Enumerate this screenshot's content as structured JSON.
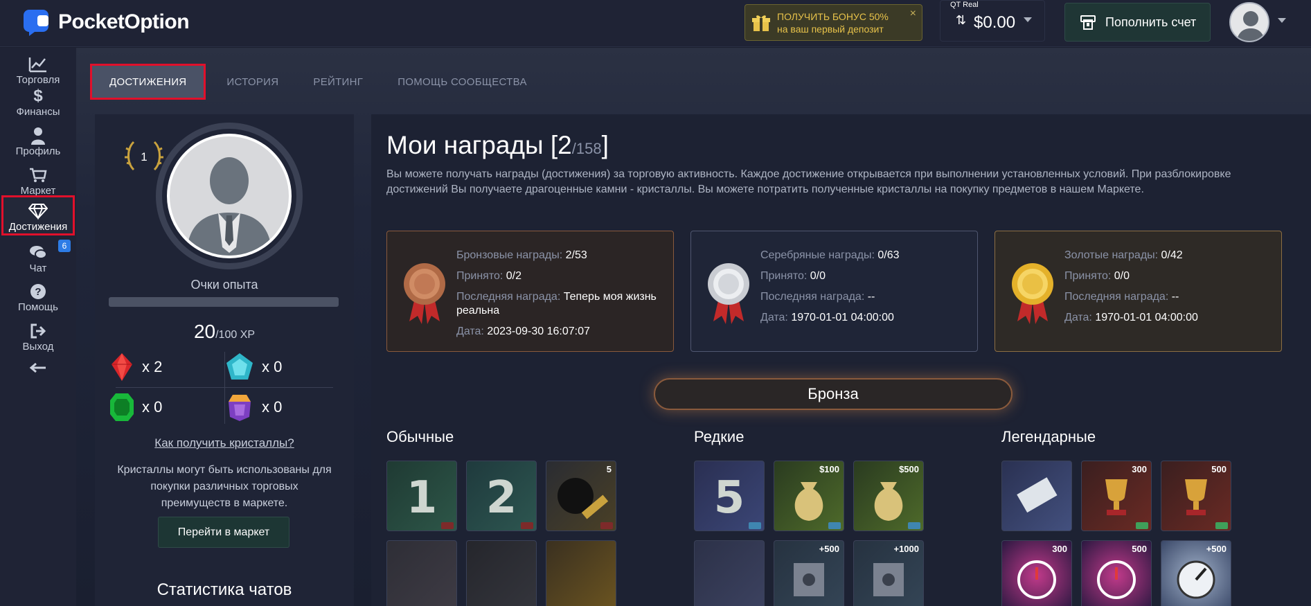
{
  "brand": {
    "name": "PocketOption"
  },
  "header": {
    "bonus_line1": "ПОЛУЧИТЬ БОНУС 50%",
    "bonus_line2": "на ваш первый депозит",
    "bonus_close": "×",
    "account_type": "QT Real",
    "balance": "$0.00",
    "deposit_label": "Пополнить счет"
  },
  "sidebar": {
    "items": [
      {
        "label": "Торговля",
        "icon": "chart-line-icon"
      },
      {
        "label": "Финансы",
        "icon": "dollar-icon"
      },
      {
        "label": "Профиль",
        "icon": "user-icon"
      },
      {
        "label": "Маркет",
        "icon": "cart-icon"
      },
      {
        "label": "Достижения",
        "icon": "diamond-icon"
      },
      {
        "label": "Чат",
        "icon": "chat-icon"
      },
      {
        "label": "Помощь",
        "icon": "question-icon"
      },
      {
        "label": "Выход",
        "icon": "logout-icon"
      }
    ],
    "chat_badge": "6",
    "collapse_icon": "arrow-left-icon"
  },
  "tabs": [
    {
      "label": "ДОСТИЖЕНИЯ",
      "active": true
    },
    {
      "label": "ИСТОРИЯ",
      "active": false
    },
    {
      "label": "РЕЙТИНГ",
      "active": false
    },
    {
      "label": "ПОМОЩЬ СООБЩЕСТВА",
      "active": false
    }
  ],
  "profile": {
    "level": "1",
    "xp_label": "Очки опыта",
    "xp_current": "20",
    "xp_total": "/100 XP",
    "xp_progress": 0.2,
    "gems": [
      {
        "name": "ruby",
        "count": "x 2"
      },
      {
        "name": "sapphire",
        "count": "x 0"
      },
      {
        "name": "emerald",
        "count": "x 0"
      },
      {
        "name": "amethyst",
        "count": "x 0"
      }
    ],
    "how_link": "Как получить кристаллы?",
    "crystals_text": "Кристаллы могут быть использованы для покупки различных торговых преимуществ в маркете.",
    "market_button": "Перейти в маркет",
    "chat_stats_title": "Статистика чатов"
  },
  "rewards": {
    "title": "Мои награды [2",
    "title_total": "/158",
    "title_close": "]",
    "description": "Вы можете получать награды (достижения) за торговую активность. Каждое достижение открывается при выполнении установленных условий. При разблокировке достижений Вы получаете драгоценные камни - кристаллы. Вы можете потратить полученные кристаллы на покупку предметов в нашем Маркете.",
    "cards": [
      {
        "type": "bronze",
        "label1": "Бронзовые награды: ",
        "value1": "2/53",
        "label2": "Принято: ",
        "value2": "0/2",
        "label3": "Последняя награда: ",
        "value3": "Теперь моя жизнь реальна",
        "label4": "Дата: ",
        "value4": "2023-09-30 16:07:07"
      },
      {
        "type": "silver",
        "label1": "Серебряные награды: ",
        "value1": "0/63",
        "label2": "Принято: ",
        "value2": "0/0",
        "label3": "Последняя награда: ",
        "value3": "--",
        "label4": "Дата: ",
        "value4": "1970-01-01 04:00:00"
      },
      {
        "type": "gold",
        "label1": "Золотые награды: ",
        "value1": "0/42",
        "label2": "Принято: ",
        "value2": "0/0",
        "label3": "Последняя награда: ",
        "value3": "--",
        "label4": "Дата: ",
        "value4": "1970-01-01 04:00:00"
      }
    ],
    "tier_button": "Бронза",
    "sections": [
      {
        "title": "Обычные"
      },
      {
        "title": "Редкие"
      },
      {
        "title": "Легендарные"
      }
    ],
    "tiles": {
      "common": [
        "1",
        "2",
        "5",
        "",
        "",
        ""
      ],
      "rare": [
        "5",
        "$100",
        "$500",
        "",
        "+500",
        "+1000"
      ],
      "legendary": [
        "",
        "300",
        "500",
        "300",
        "500",
        "+500"
      ]
    }
  },
  "colors": {
    "accent_red": "#e1102b",
    "bronze": "#b06a46",
    "silver": "#c9ccd2",
    "gold": "#e4b12a",
    "badge_blue": "#2d7ce6"
  }
}
